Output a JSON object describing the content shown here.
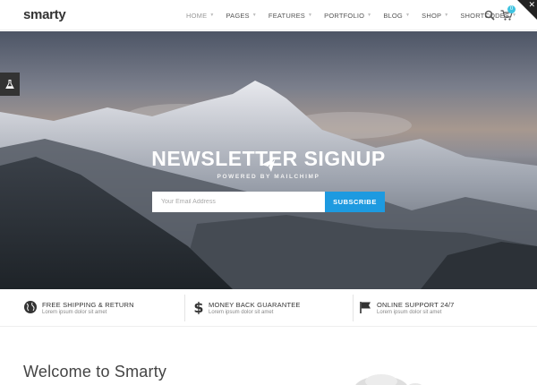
{
  "header": {
    "logo": "smarty",
    "nav": [
      {
        "label": "HOME",
        "active": true
      },
      {
        "label": "PAGES",
        "active": false
      },
      {
        "label": "FEATURES",
        "active": false
      },
      {
        "label": "PORTFOLIO",
        "active": false
      },
      {
        "label": "BLOG",
        "active": false
      },
      {
        "label": "SHOP",
        "active": false
      },
      {
        "label": "SHORTCODES",
        "active": false
      }
    ],
    "cart_count": "0"
  },
  "hero": {
    "title": "NEWSLETTER SIGNUP",
    "subtitle": "POWERED BY MAILCHIMP",
    "email_placeholder": "Your Email Address",
    "subscribe_label": "SUBSCRIBE"
  },
  "features": [
    {
      "icon": "globe-icon",
      "title": "FREE SHIPPING & RETURN",
      "desc": "Lorem ipsum dolor sit amet"
    },
    {
      "icon": "dollar-icon",
      "title": "MONEY BACK GUARANTEE",
      "desc": "Lorem ipsum dolor sit amet"
    },
    {
      "icon": "flag-icon",
      "title": "ONLINE SUPPORT 24/7",
      "desc": "Lorem ipsum dolor sit amet"
    }
  ],
  "welcome": {
    "heading": "Welcome to Smarty"
  },
  "colors": {
    "accent": "#1d9ae0",
    "badge": "#3ec3e0"
  }
}
